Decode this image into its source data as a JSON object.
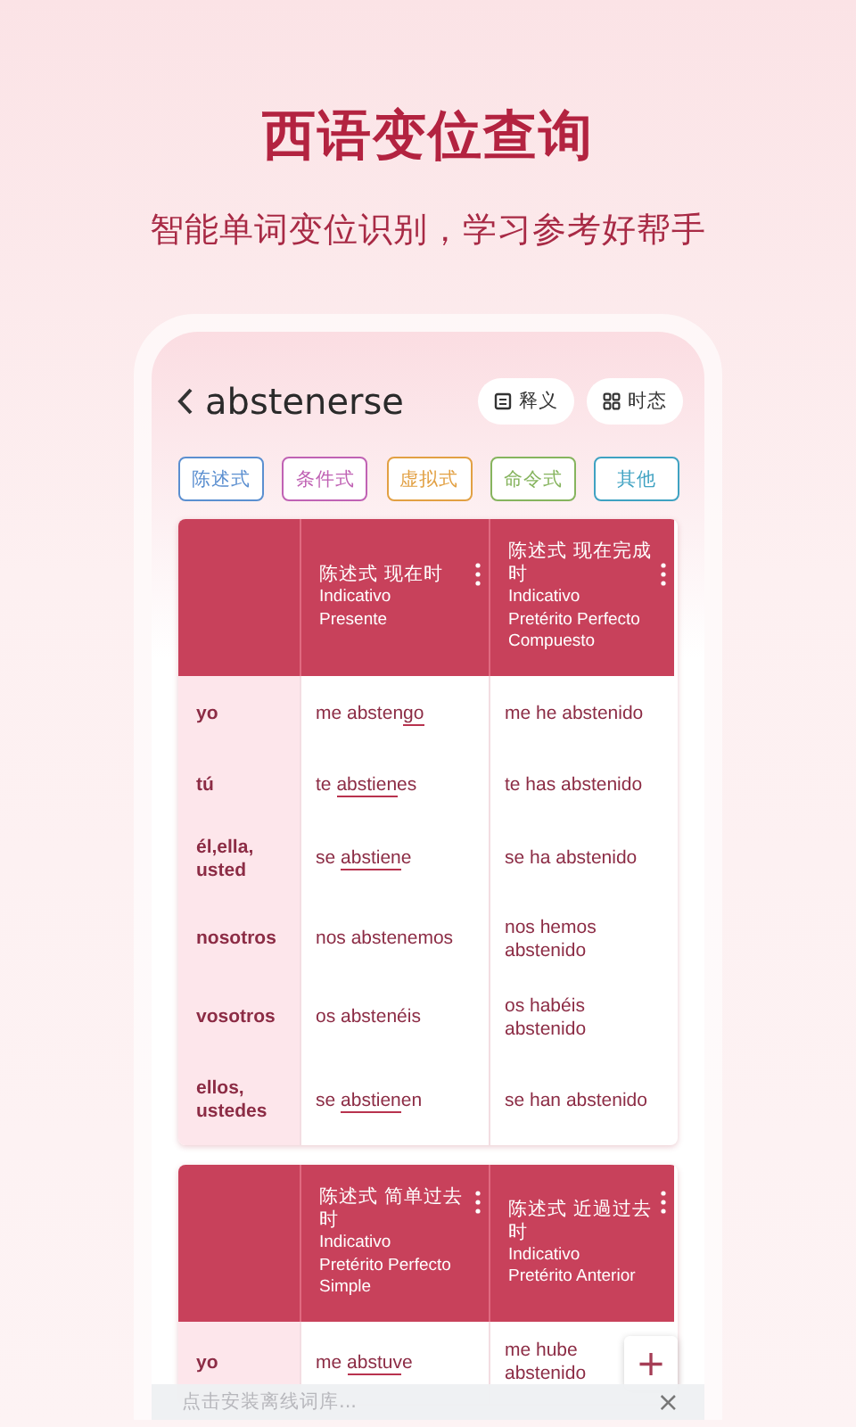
{
  "title": "西语变位查询",
  "subtitle": "智能单词变位识别，学习参考好帮手",
  "word": "abstenerse",
  "buttons": [
    {
      "label": "释义",
      "kind": "definition"
    },
    {
      "label": "时态",
      "kind": "tenses"
    }
  ],
  "moods": [
    {
      "label": "陈述式",
      "color": "#5b8fd0"
    },
    {
      "label": "条件式",
      "color": "#c062b4"
    },
    {
      "label": "虚拟式",
      "color": "#e2a043"
    },
    {
      "label": "命令式",
      "color": "#86b45e"
    },
    {
      "label": "其他",
      "color": "#3fa2c2"
    }
  ],
  "tables": [
    {
      "columns": [
        {
          "zh": "陈述式 现在时",
          "es": [
            "Indicativo",
            "Presente"
          ]
        },
        {
          "zh": "陈述式 现在完成时",
          "es": [
            "Indicativo",
            "Pretérito Perfecto",
            "Compuesto"
          ]
        }
      ],
      "rows": [
        {
          "person": "yo",
          "forms": [
            [
              {
                "text": "me absten",
                "irregular": false
              },
              {
                "text": "go",
                "irregular": true
              }
            ],
            [
              {
                "text": "me he abstenido",
                "irregular": false
              }
            ]
          ]
        },
        {
          "person": "tú",
          "forms": [
            [
              {
                "text": "te ",
                "irregular": false
              },
              {
                "text": "abstien",
                "irregular": true
              },
              {
                "text": "es",
                "irregular": false
              }
            ],
            [
              {
                "text": "te has abstenido",
                "irregular": false
              }
            ]
          ]
        },
        {
          "person": "él,ella, usted",
          "forms": [
            [
              {
                "text": "se ",
                "irregular": false
              },
              {
                "text": "abstien",
                "irregular": true
              },
              {
                "text": "e",
                "irregular": false
              }
            ],
            [
              {
                "text": "se ha abstenido",
                "irregular": false
              }
            ]
          ]
        },
        {
          "person": "nosotros",
          "forms": [
            [
              {
                "text": "nos abstenemos",
                "irregular": false
              }
            ],
            [
              {
                "text": "nos hemos abstenido",
                "irregular": false
              }
            ]
          ]
        },
        {
          "person": "vosotros",
          "forms": [
            [
              {
                "text": "os abstenéis",
                "irregular": false
              }
            ],
            [
              {
                "text": "os habéis abstenido",
                "irregular": false
              }
            ]
          ]
        },
        {
          "person": "ellos, ustedes",
          "forms": [
            [
              {
                "text": "se ",
                "irregular": false
              },
              {
                "text": "abstien",
                "irregular": true
              },
              {
                "text": "en",
                "irregular": false
              }
            ],
            [
              {
                "text": "se han abstenido",
                "irregular": false
              }
            ]
          ]
        }
      ]
    },
    {
      "columns": [
        {
          "zh": "陈述式 简单过去时",
          "es": [
            "Indicativo",
            "Pretérito Perfecto",
            "Simple"
          ]
        },
        {
          "zh": "陈述式 近過过去时",
          "es": [
            "Indicativo",
            "Pretérito Anterior"
          ]
        }
      ],
      "rows": [
        {
          "person": "yo",
          "forms": [
            [
              {
                "text": "me ",
                "irregular": false
              },
              {
                "text": "abstuv",
                "irregular": true
              },
              {
                "text": "e",
                "irregular": false
              }
            ],
            [
              {
                "text": "me hube abstenido",
                "irregular": false
              }
            ]
          ]
        }
      ]
    }
  ],
  "add": "+",
  "footer": {
    "text": "点击安装离线词库...",
    "close": "×"
  }
}
